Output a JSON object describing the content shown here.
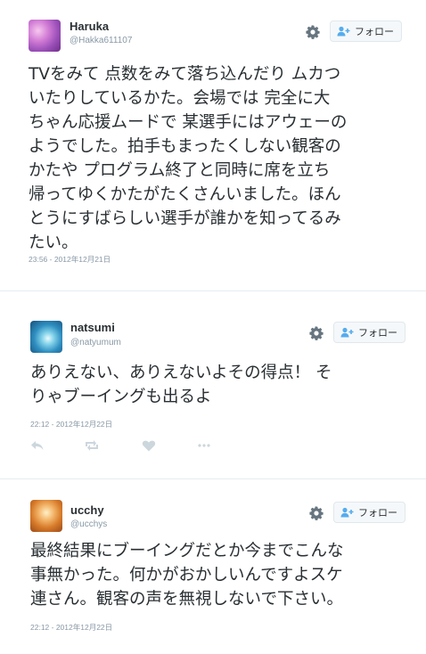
{
  "follow_label": "フォロー",
  "tweets": [
    {
      "name": "Haruka",
      "handle": "@Hakka611107",
      "text": "TVをみて 点数をみて落ち込んだり ムカつ\nいたりしているかた。会場では 完全に大\nちゃん応援ムードで 某選手にはアウェーの\nようでした。拍手もまったくしない観客の\nかたや プログラム終了と同時に席を立ち\n帰ってゆくかたがたくさんいました。ほん\nとうにすばらしい選手が誰かを知ってるみ\nたい。",
      "timestamp": "23:56 - 2012年12月21日"
    },
    {
      "name": "natsumi",
      "handle": "@natyumum",
      "text": "ありえない、ありえないよその得点！ そ\nりゃブーイングも出るよ",
      "timestamp": "22:12 - 2012年12月22日",
      "actions": [
        "reply-icon",
        "retweet-icon",
        "like-icon",
        "more-icon"
      ]
    },
    {
      "name": "ucchy",
      "handle": "@ucchys",
      "text": "最終結果にブーイングだとか今までこんな\n事無かった。何かがおかしいんですよスケ\n連さん。観客の声を無視しないで下さい。",
      "timestamp": "22:12 - 2012年12月22日"
    }
  ]
}
